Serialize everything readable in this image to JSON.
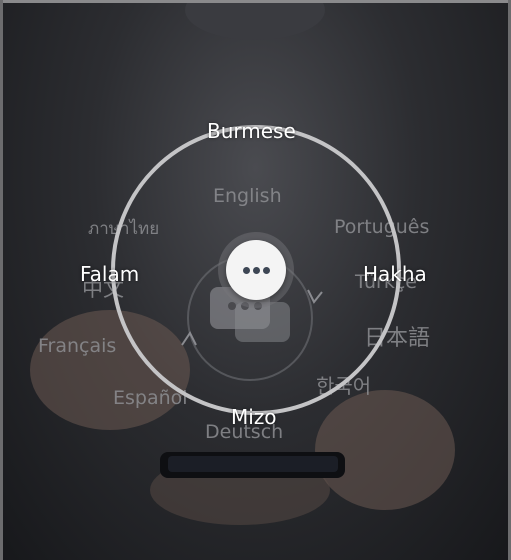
{
  "background": {
    "words": [
      {
        "id": "english",
        "text": "English"
      },
      {
        "id": "thai",
        "text": "ภาษาไทย"
      },
      {
        "id": "portugues",
        "text": "Português"
      },
      {
        "id": "chinese",
        "text": "中文"
      },
      {
        "id": "turkce",
        "text": "Türkçe"
      },
      {
        "id": "japanese",
        "text": "日本語"
      },
      {
        "id": "francais",
        "text": "Français"
      },
      {
        "id": "korean",
        "text": "한국어"
      },
      {
        "id": "espanol",
        "text": "Español"
      },
      {
        "id": "deutsch",
        "text": "Deutsch"
      }
    ]
  },
  "wheel": {
    "top_label": "Burmese",
    "left_label": "Falam",
    "right_label": "Hakha",
    "bottom_label": "Mizo",
    "center_icon": "more-dots-icon"
  },
  "colors": {
    "ring": "#c4c4c6",
    "center_button": "#f4f4f4",
    "dots": "#3d4654"
  }
}
